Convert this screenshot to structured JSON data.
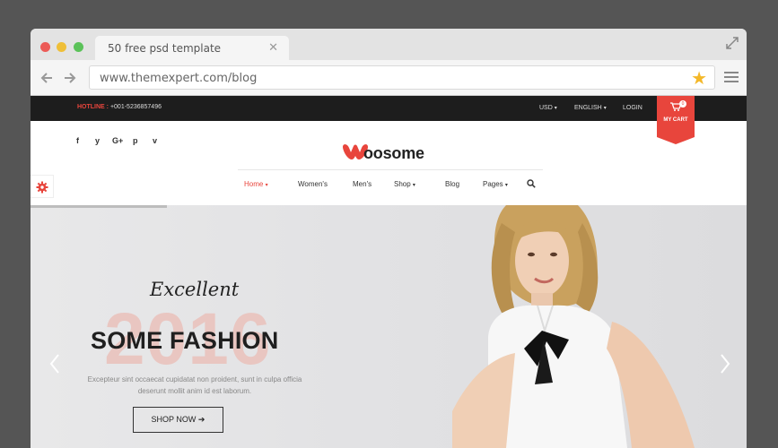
{
  "browser": {
    "tab_title": "50 free psd  template",
    "tab_close": "✕",
    "url": "www.themexpert.com/blog",
    "star": "★"
  },
  "topbar": {
    "hotline_label": "HOTLINE :",
    "hotline_number": "+001-5236857496",
    "currency": "USD",
    "language": "ENGLISH",
    "login": "LOGIN",
    "cart_label": "MY CART",
    "cart_count": "0"
  },
  "social": [
    "f",
    "y",
    "G+",
    "p",
    "v"
  ],
  "logo": {
    "text": "oosome"
  },
  "nav": {
    "items": [
      {
        "label": "Home",
        "caret": "▾"
      },
      {
        "label": "Women's"
      },
      {
        "label": "Men's"
      },
      {
        "label": "Shop",
        "caret": "▾"
      },
      {
        "label": "Blog"
      },
      {
        "label": "Pages",
        "caret": "▾"
      }
    ]
  },
  "hero": {
    "script": "Excellent",
    "year": "2016",
    "headline": "SOME FASHION",
    "description": "Excepteur sint occaecat cupidatat non proident, sunt in culpa officia deserunt mollit anim id est laborum.",
    "button": "SHOP NOW",
    "button_arrow": "➔",
    "slide_progress": 0.19
  },
  "colors": {
    "accent": "#e8453c",
    "topbar": "#1d1d1d"
  }
}
